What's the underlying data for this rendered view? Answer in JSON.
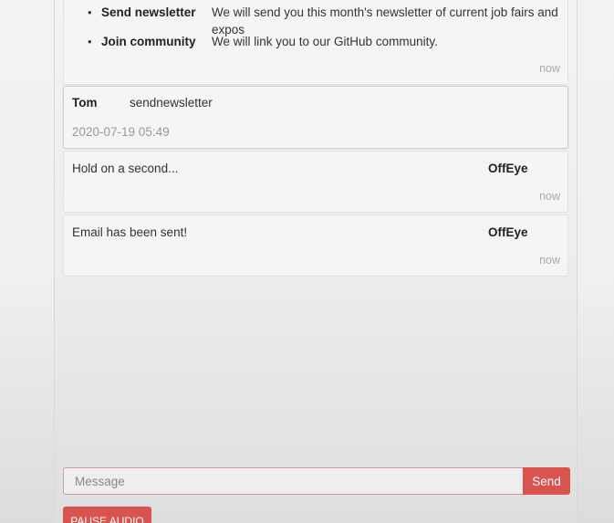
{
  "chat": {
    "options_card": {
      "options": [
        {
          "name": "Send newsletter",
          "description": "We will send you this month's newsletter of current job fairs and expos"
        },
        {
          "name": "Join community",
          "description": "We will link you to our GitHub community."
        }
      ],
      "time": "now"
    },
    "user_message": {
      "sender": "Tom",
      "text": "sendnewsletter",
      "timestamp": "2020-07-19 05:49"
    },
    "bot_messages": [
      {
        "text": "Hold on a second...",
        "sender": "OffEye",
        "time": "now"
      },
      {
        "text": "Email has been sent!",
        "sender": "OffEye",
        "time": "now"
      }
    ]
  },
  "composer": {
    "placeholder": "Message",
    "send_label": "Send"
  },
  "controls": {
    "pause_audio_label": "PAUSE AUDIO"
  },
  "colors": {
    "accent": "#d9534f",
    "panel_background": "#f0f0f0",
    "muted_text": "#aaaaaa"
  },
  "icons": [
    "mouse-cursor-icon"
  ]
}
